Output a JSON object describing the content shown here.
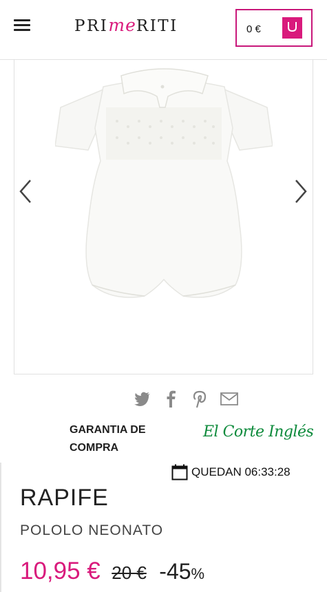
{
  "header": {
    "logo_left": "PRI",
    "logo_mid": "me",
    "logo_right": "RITI",
    "cart_amount": "0 €",
    "accent_color": "#d91a7c"
  },
  "gallery": {
    "image_description_icon": "baby-romper-image",
    "prev_icon": "chevron-left-icon",
    "next_icon": "chevron-right-icon"
  },
  "share": {
    "icons": [
      "twitter-icon",
      "facebook-icon",
      "pinterest-icon",
      "email-icon"
    ]
  },
  "guarantee": {
    "line1": "GARANTIA DE",
    "line2": "COMPRA",
    "partner_logo": "El Corte Inglés"
  },
  "countdown": {
    "label": "QUEDAN 06:33:28"
  },
  "product": {
    "brand": "RAPIFE",
    "name": "POLOLO NEONATO",
    "price": "10,95 €",
    "old_price": "20 €",
    "discount": "-45",
    "discount_pct": "%"
  }
}
